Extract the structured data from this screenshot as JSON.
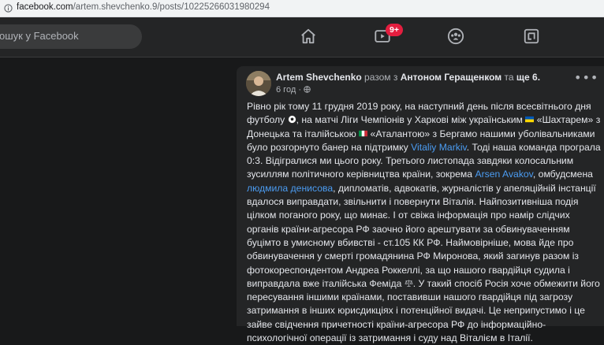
{
  "browser": {
    "url_domain": "facebook.com",
    "url_path": "/artem.shevchenko.9/posts/10225266031980294"
  },
  "topbar": {
    "search_placeholder": "ошук у Facebook",
    "watch_badge": "9+",
    "icons": [
      "home-icon",
      "watch-icon",
      "groups-icon",
      "gaming-icon"
    ]
  },
  "post": {
    "author": "Artem Shevchenko",
    "with_word": "разом з",
    "tagged": "Антоном Геращенком",
    "and_word": "та",
    "others": "ще 6",
    "time": "6 год",
    "privacy": "public-globe-icon",
    "lines": [
      [
        "Рівно рік тому 11 грудня 2019 року, на наступний день після всесвітнього дня"
      ],
      [
        "футболу ",
        {
          "emoji": "soccer"
        },
        ", на матчі Ліги Чемпіонів у Харкові між українським ",
        {
          "emoji": "ua-flag"
        },
        " «Шахтарем» з"
      ],
      [
        "Донецька та італійською ",
        {
          "emoji": "it-flag"
        },
        " «Аталантою» з Бергамо нашими уболівальниками"
      ],
      [
        "було розгорнуто банер на підтримку ",
        {
          "link": "Vitaliy Markiv"
        },
        ". Тоді наша команда програла"
      ],
      [
        "0:3. Відігралися ми цього року. Третього листопада завдяки колосальним"
      ],
      [
        "зусиллям політичного керівництва країни, зокрема ",
        {
          "link": "Arsen  Avakov"
        },
        ", омбудсмена"
      ],
      [
        {
          "link": "людмила денисова"
        },
        ", дипломатів, адвокатів, журналістів у апеляційній інстанції"
      ],
      [
        "вдалося виправдати, звільнити і повернути Віталія. Найпозитивніша подія"
      ],
      [
        "цілком поганого року, що минає. І от свіжа інформація про намір слідчих"
      ],
      [
        "органів країни-агресора РФ заочно його арештувати за обвинуваченням"
      ],
      [
        "буцімто в умисному вбивстві - ст.105 КК РФ. Наймовірніше, мова йде про"
      ],
      [
        "обвинувачення у смерті громадянина РФ Миронова, який загинув разом із"
      ],
      [
        "фотокореспондентом Андреа Роккеллі, за що нашого гвардійця судила і"
      ],
      [
        "виправдала вже італійська Феміда ",
        {
          "emoji": "scales"
        },
        ". У такий спосіб Росія хоче обмежити його"
      ],
      [
        "пересування іншими країнами, поставивши нашого гвардійця під загрозу"
      ],
      [
        "затримання в інших юрисдикціях і потенційної видачі. Це неприпустимо і це"
      ],
      [
        "зайве свідчення причетності країни-агресора РФ до інформаційно-"
      ],
      [
        "психологічної операції із затримання і суду над Віталієм в Італії."
      ]
    ]
  },
  "colors": {
    "page_bg": "#18191a",
    "surface": "#242526",
    "text": "#e4e6eb",
    "secondary_text": "#b0b3b8",
    "link": "#4b9cf2",
    "badge": "#e41e3f"
  }
}
